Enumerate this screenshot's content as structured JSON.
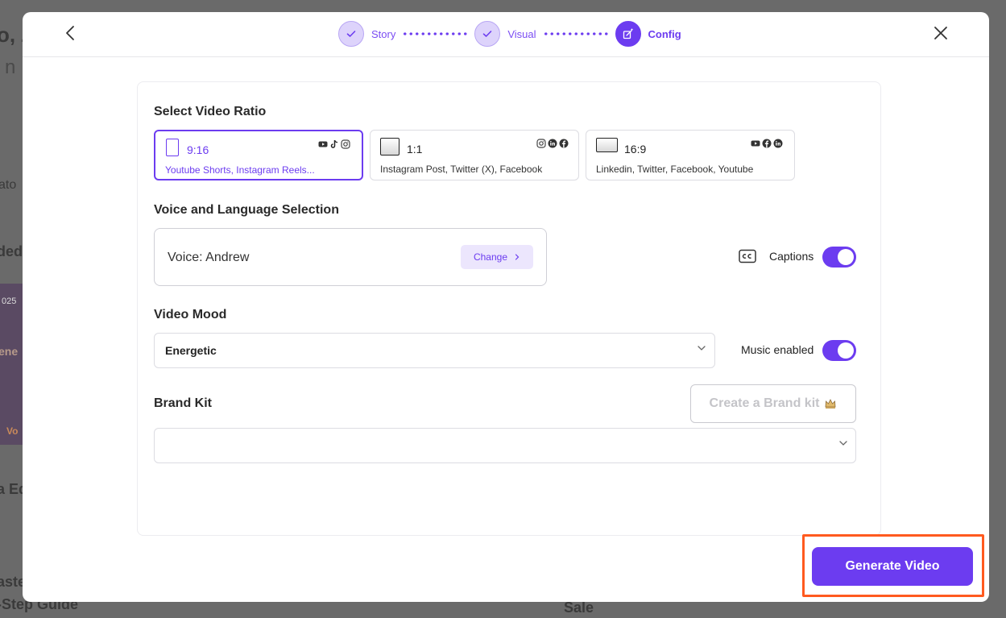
{
  "background": {
    "fragments": [
      "o, Z",
      "n",
      "ato",
      "ded",
      "025",
      "ene",
      "Vo",
      "a Ed",
      "aste",
      "-Step Guide",
      "Sale"
    ]
  },
  "stepper": {
    "steps": [
      {
        "label": "Story",
        "state": "done"
      },
      {
        "label": "Visual",
        "state": "done"
      },
      {
        "label": "Config",
        "state": "active"
      }
    ]
  },
  "ratio": {
    "title": "Select Video Ratio",
    "options": [
      {
        "value": "9:16",
        "description": "Youtube Shorts, Instagram Reels...",
        "icons": [
          "youtube-icon",
          "tiktok-icon",
          "instagram-icon"
        ],
        "selected": true
      },
      {
        "value": "1:1",
        "description": "Instagram Post, Twitter (X), Facebook",
        "icons": [
          "instagram-icon",
          "linkedin-icon",
          "facebook-icon"
        ],
        "selected": false
      },
      {
        "value": "16:9",
        "description": "Linkedin, Twitter, Facebook, Youtube",
        "icons": [
          "youtube-icon",
          "facebook-icon",
          "linkedin-icon"
        ],
        "selected": false
      }
    ]
  },
  "voice": {
    "title": "Voice and Language Selection",
    "label": "Voice: Andrew",
    "change_label": "Change",
    "captions_label": "Captions",
    "captions_enabled": true
  },
  "mood": {
    "title": "Video Mood",
    "value": "Energetic",
    "music_label": "Music enabled",
    "music_enabled": true
  },
  "brand_kit": {
    "title": "Brand Kit",
    "create_label": "Create a Brand kit",
    "value": ""
  },
  "footer": {
    "generate_label": "Generate Video"
  },
  "colors": {
    "accent": "#6c3cf0",
    "highlight": "#ff5a1f"
  }
}
